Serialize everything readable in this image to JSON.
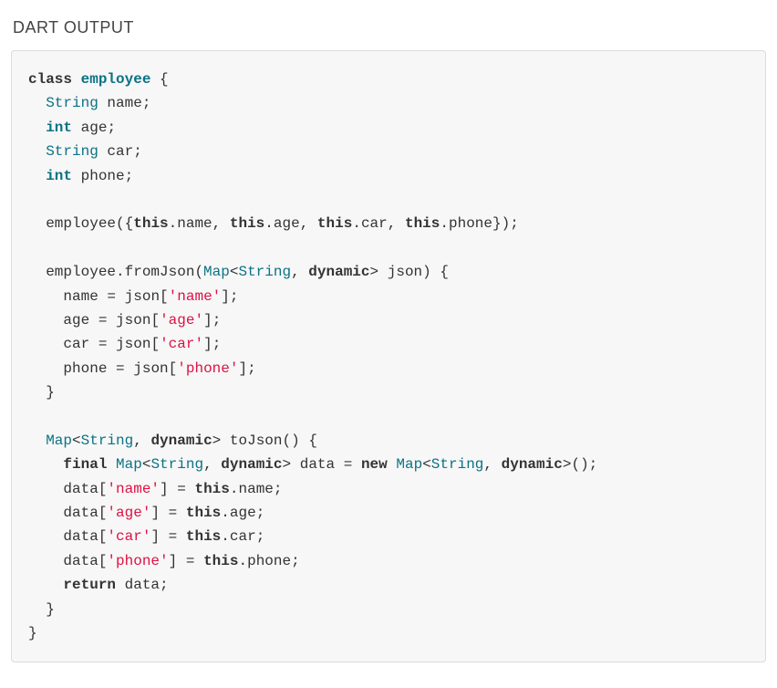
{
  "heading": "DART OUTPUT",
  "kw": {
    "class": "class",
    "this": "this",
    "dynamic": "dynamic",
    "final": "final",
    "new": "new",
    "return": "return"
  },
  "types": {
    "Map": "Map",
    "String": "String",
    "int": "int"
  },
  "classname": "employee",
  "fields": {
    "name": "name",
    "age": "age",
    "car": "car",
    "phone": "phone"
  },
  "methods": {
    "fromJson": "fromJson",
    "toJson": "toJson",
    "json": "json",
    "data": "data"
  },
  "strings": {
    "name": "'name'",
    "age": "'age'",
    "car": "'car'",
    "phone": "'phone'"
  },
  "punct": {
    "obrace": "{",
    "cbrace": "}",
    "semi": ";",
    "lt": "<",
    "gt": ">",
    "comma": ",",
    "oparen": "(",
    "cparen": ")",
    "dot": ".",
    "eq": "=",
    "osq": "[",
    "csq": "]",
    "sp": " "
  }
}
